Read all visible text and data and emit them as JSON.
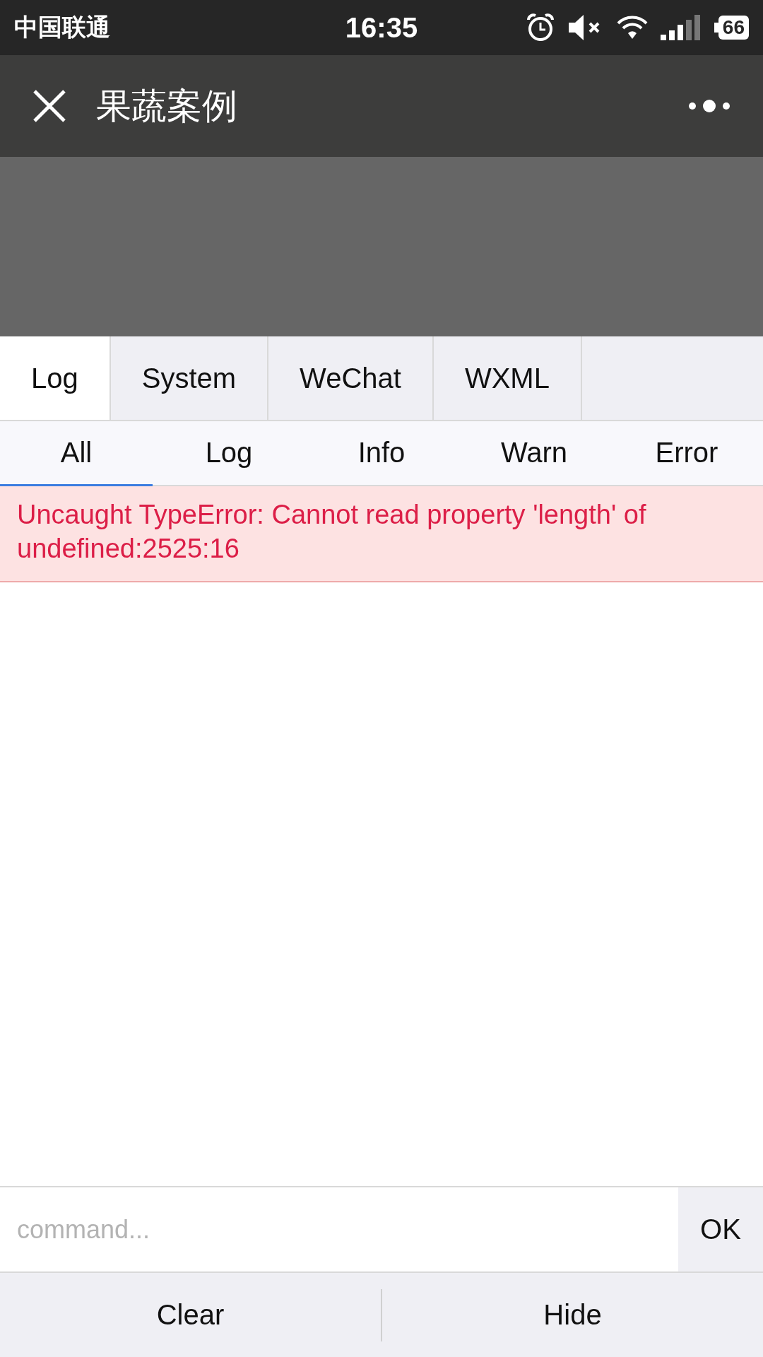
{
  "status_bar": {
    "carrier": "中国联通",
    "time": "16:35",
    "battery": "66"
  },
  "nav_bar": {
    "title": "果蔬案例"
  },
  "panel_tabs": [
    {
      "label": "Log",
      "selected": true
    },
    {
      "label": "System",
      "selected": false
    },
    {
      "label": "WeChat",
      "selected": false
    },
    {
      "label": "WXML",
      "selected": false
    }
  ],
  "filter_tabs": [
    {
      "label": "All",
      "selected": true
    },
    {
      "label": "Log",
      "selected": false
    },
    {
      "label": "Info",
      "selected": false
    },
    {
      "label": "Warn",
      "selected": false
    },
    {
      "label": "Error",
      "selected": false
    }
  ],
  "log_entries": [
    {
      "kind": "error",
      "text": "Uncaught TypeError: Cannot read property 'length' of undefined:2525:16"
    }
  ],
  "command": {
    "placeholder": "command...",
    "button": "OK"
  },
  "footer_buttons": [
    "Clear",
    "Hide"
  ]
}
